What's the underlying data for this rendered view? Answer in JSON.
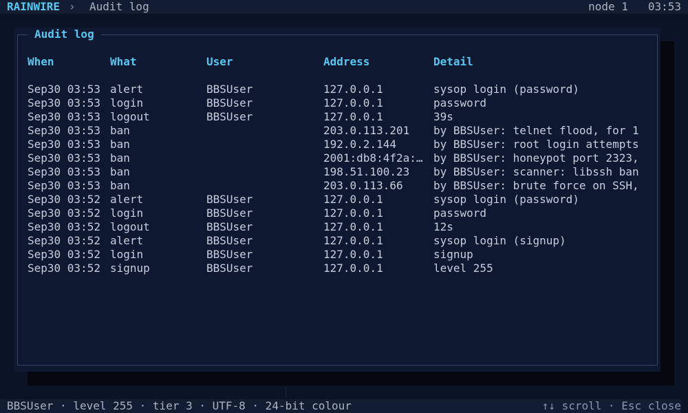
{
  "topbar": {
    "brand": "RAINWIRE",
    "separator": "›",
    "breadcrumb": "Audit log",
    "node": "node 1",
    "time": "03:53"
  },
  "modal": {
    "title": "Audit log",
    "columns": [
      "When",
      "What",
      "User",
      "Address",
      "Detail"
    ],
    "rows": [
      {
        "when": "Sep30 03:53",
        "what": "alert",
        "user": "BBSUser",
        "address": "127.0.0.1",
        "detail": "sysop login (password)"
      },
      {
        "when": "Sep30 03:53",
        "what": "login",
        "user": "BBSUser",
        "address": "127.0.0.1",
        "detail": "password"
      },
      {
        "when": "Sep30 03:53",
        "what": "logout",
        "user": "BBSUser",
        "address": "127.0.0.1",
        "detail": "39s"
      },
      {
        "when": "Sep30 03:53",
        "what": "ban",
        "user": "",
        "address": "203.0.113.201",
        "detail": "by BBSUser: telnet flood, for 1"
      },
      {
        "when": "Sep30 03:53",
        "what": "ban",
        "user": "",
        "address": "192.0.2.144",
        "detail": "by BBSUser: root login attempts"
      },
      {
        "when": "Sep30 03:53",
        "what": "ban",
        "user": "",
        "address": "2001:db8:4f2a:…",
        "detail": "by BBSUser: honeypot port 2323,"
      },
      {
        "when": "Sep30 03:53",
        "what": "ban",
        "user": "",
        "address": "198.51.100.23",
        "detail": "by BBSUser: scanner: libssh ban"
      },
      {
        "when": "Sep30 03:53",
        "what": "ban",
        "user": "",
        "address": "203.0.113.66",
        "detail": "by BBSUser: brute force on SSH,"
      },
      {
        "when": "Sep30 03:52",
        "what": "alert",
        "user": "BBSUser",
        "address": "127.0.0.1",
        "detail": "sysop login (password)"
      },
      {
        "when": "Sep30 03:52",
        "what": "login",
        "user": "BBSUser",
        "address": "127.0.0.1",
        "detail": "password"
      },
      {
        "when": "Sep30 03:52",
        "what": "logout",
        "user": "BBSUser",
        "address": "127.0.0.1",
        "detail": "12s"
      },
      {
        "when": "Sep30 03:52",
        "what": "alert",
        "user": "BBSUser",
        "address": "127.0.0.1",
        "detail": "sysop login (signup)"
      },
      {
        "when": "Sep30 03:52",
        "what": "login",
        "user": "BBSUser",
        "address": "127.0.0.1",
        "detail": "signup"
      },
      {
        "when": "Sep30 03:52",
        "what": "signup",
        "user": "BBSUser",
        "address": "127.0.0.1",
        "detail": "level 255"
      }
    ]
  },
  "statusbar": {
    "left": "BBSUser · level 255 · tier 3 · UTF-8 · 24-bit colour",
    "right": "↑↓ scroll · Esc close"
  },
  "colors": {
    "accent": "#58c8f2",
    "background": "#0a1426",
    "panel": "#0e1830",
    "text": "#c6cfdd"
  }
}
